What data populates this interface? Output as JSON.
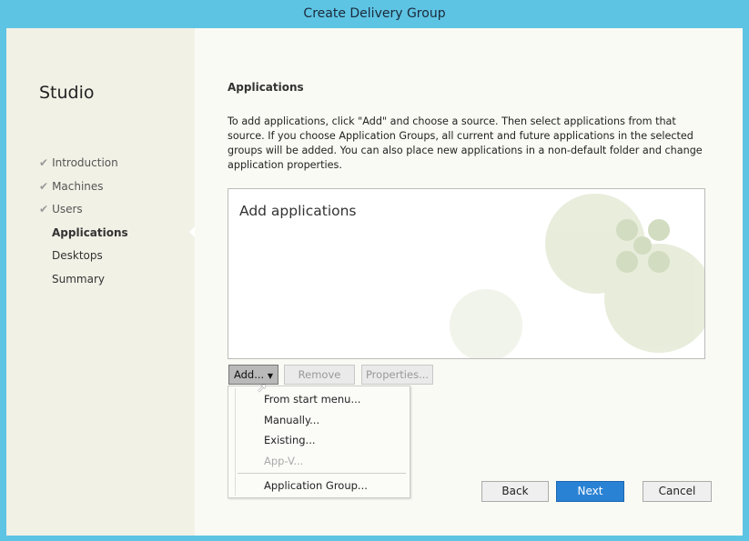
{
  "window": {
    "title": "Create Delivery Group"
  },
  "sidebar": {
    "title": "Studio",
    "items": [
      {
        "label": "Introduction",
        "state": "done"
      },
      {
        "label": "Machines",
        "state": "done"
      },
      {
        "label": "Users",
        "state": "done"
      },
      {
        "label": "Applications",
        "state": "active"
      },
      {
        "label": "Desktops",
        "state": "pending"
      },
      {
        "label": "Summary",
        "state": "pending"
      }
    ]
  },
  "main": {
    "heading": "Applications",
    "description": "To add applications, click \"Add\" and choose a source. Then select applications from that source. If you choose Application Groups, all current and future applications in the selected groups will be added. You can also place new applications in a non-default folder and change application properties.",
    "list_label": "Add applications",
    "buttons": {
      "add": "Add...",
      "remove": "Remove",
      "properties": "Properties..."
    },
    "add_menu": [
      "From start menu...",
      "Manually...",
      "Existing...",
      "App-V...",
      "Application Group..."
    ]
  },
  "footer": {
    "back": "Back",
    "next": "Next",
    "cancel": "Cancel"
  },
  "colors": {
    "title_bar": "#5ec4e4",
    "primary": "#2a82d4"
  }
}
